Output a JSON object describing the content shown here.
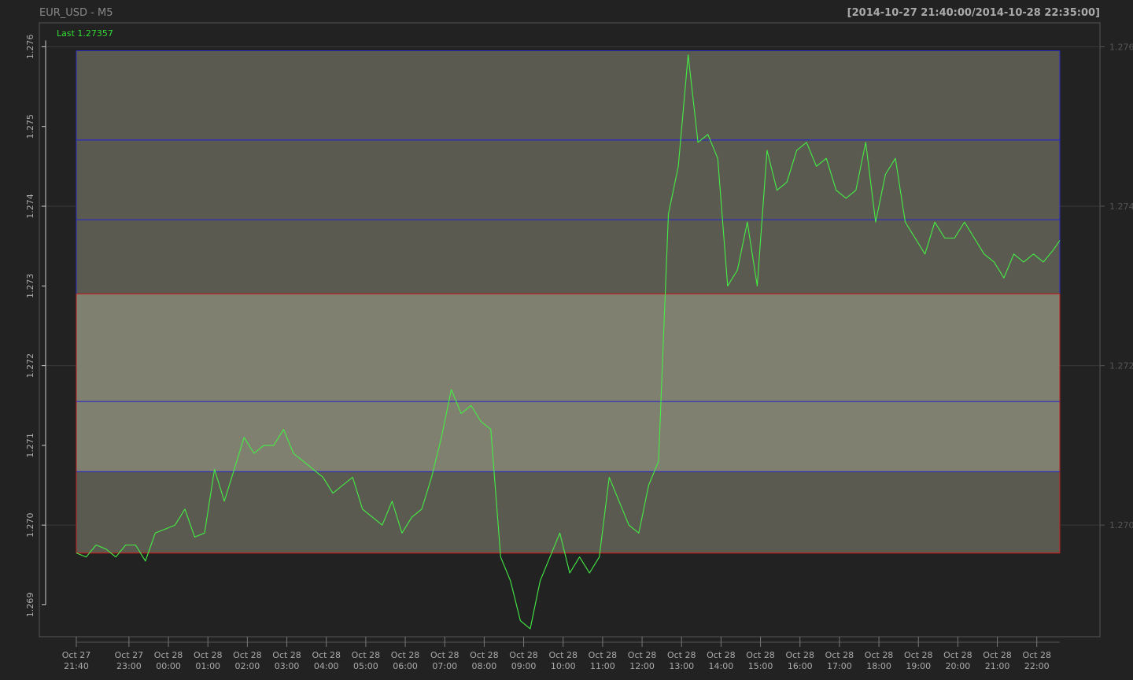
{
  "header": {
    "title": "EUR_USD - M5",
    "date_range": "[2014-10-27 21:40:00/2014-10-28 22:35:00]",
    "last_label": "Last 1.27357"
  },
  "colors": {
    "background": "#222222",
    "plot_frame": "#555555",
    "grid": "#3a3a3a",
    "price_line": "#44ee44",
    "upper_zone_fill": "#5a5a50",
    "middle_zone_fill": "#808070",
    "lower_zone_fill": "#5a5a50",
    "blue_line": "#2a2ac0",
    "red_line": "#c02020",
    "axis_text": "#aaaaaa",
    "right_axis_text": "#555555",
    "title_text": "#888888",
    "range_text": "#aaaaaa",
    "last_text": "#33dd33"
  },
  "chart_data": {
    "type": "line",
    "title": "EUR_USD - M5",
    "series": [
      {
        "name": "",
        "x": [
          "2014-10-27 21:40",
          "2014-10-27 21:55",
          "2014-10-27 22:10",
          "2014-10-27 22:25",
          "2014-10-27 22:40",
          "2014-10-27 22:55",
          "2014-10-27 23:10",
          "2014-10-27 23:25",
          "2014-10-27 23:40",
          "2014-10-27 23:55",
          "2014-10-28 00:10",
          "2014-10-28 00:25",
          "2014-10-28 00:40",
          "2014-10-28 00:55",
          "2014-10-28 01:10",
          "2014-10-28 01:25",
          "2014-10-28 01:40",
          "2014-10-28 01:55",
          "2014-10-28 02:10",
          "2014-10-28 02:25",
          "2014-10-28 02:40",
          "2014-10-28 02:55",
          "2014-10-28 03:10",
          "2014-10-28 03:25",
          "2014-10-28 03:40",
          "2014-10-28 03:55",
          "2014-10-28 04:10",
          "2014-10-28 04:25",
          "2014-10-28 04:40",
          "2014-10-28 04:55",
          "2014-10-28 05:10",
          "2014-10-28 05:25",
          "2014-10-28 05:40",
          "2014-10-28 05:55",
          "2014-10-28 06:10",
          "2014-10-28 06:25",
          "2014-10-28 06:40",
          "2014-10-28 06:55",
          "2014-10-28 07:10",
          "2014-10-28 07:25",
          "2014-10-28 07:40",
          "2014-10-28 07:55",
          "2014-10-28 08:10",
          "2014-10-28 08:25",
          "2014-10-28 08:40",
          "2014-10-28 08:55",
          "2014-10-28 09:10",
          "2014-10-28 09:25",
          "2014-10-28 09:40",
          "2014-10-28 09:55",
          "2014-10-28 10:10",
          "2014-10-28 10:25",
          "2014-10-28 10:40",
          "2014-10-28 10:55",
          "2014-10-28 11:10",
          "2014-10-28 11:25",
          "2014-10-28 11:40",
          "2014-10-28 11:55",
          "2014-10-28 12:10",
          "2014-10-28 12:25",
          "2014-10-28 12:40",
          "2014-10-28 12:55",
          "2014-10-28 13:10",
          "2014-10-28 13:25",
          "2014-10-28 13:40",
          "2014-10-28 13:55",
          "2014-10-28 14:10",
          "2014-10-28 14:25",
          "2014-10-28 14:40",
          "2014-10-28 14:55",
          "2014-10-28 15:10",
          "2014-10-28 15:25",
          "2014-10-28 15:40",
          "2014-10-28 15:55",
          "2014-10-28 16:10",
          "2014-10-28 16:25",
          "2014-10-28 16:40",
          "2014-10-28 16:55",
          "2014-10-28 17:10",
          "2014-10-28 17:25",
          "2014-10-28 17:40",
          "2014-10-28 17:55",
          "2014-10-28 18:10",
          "2014-10-28 18:25",
          "2014-10-28 18:40",
          "2014-10-28 18:55",
          "2014-10-28 19:10",
          "2014-10-28 19:25",
          "2014-10-28 19:40",
          "2014-10-28 19:55",
          "2014-10-28 20:10",
          "2014-10-28 20:25",
          "2014-10-28 20:40",
          "2014-10-28 20:55",
          "2014-10-28 21:10",
          "2014-10-28 21:25",
          "2014-10-28 21:40",
          "2014-10-28 21:55",
          "2014-10-28 22:10",
          "2014-10-28 22:25",
          "2014-10-28 22:35"
        ],
        "values": [
          1.26965,
          1.2696,
          1.26975,
          1.2697,
          1.2696,
          1.26975,
          1.26975,
          1.26955,
          1.2699,
          1.26995,
          1.27,
          1.2702,
          1.26985,
          1.2699,
          1.2707,
          1.2703,
          1.2707,
          1.2711,
          1.2709,
          1.271,
          1.271,
          1.2712,
          1.2709,
          1.2708,
          1.2707,
          1.2706,
          1.2704,
          1.2705,
          1.2706,
          1.2702,
          1.2701,
          1.27,
          1.2703,
          1.2699,
          1.2701,
          1.2702,
          1.2706,
          1.2711,
          1.2717,
          1.2714,
          1.2715,
          1.2713,
          1.2712,
          1.2696,
          1.2693,
          1.2688,
          1.2687,
          1.2693,
          1.2696,
          1.2699,
          1.2694,
          1.2696,
          1.2694,
          1.2696,
          1.2706,
          1.2703,
          1.27,
          1.2699,
          1.2705,
          1.2708,
          1.2739,
          1.2745,
          1.2759,
          1.2748,
          1.2749,
          1.2746,
          1.273,
          1.2732,
          1.2738,
          1.273,
          1.2747,
          1.2742,
          1.2743,
          1.2747,
          1.2748,
          1.2745,
          1.2746,
          1.2742,
          1.2741,
          1.2742,
          1.2748,
          1.2738,
          1.2744,
          1.2746,
          1.2738,
          1.2736,
          1.2734,
          1.2738,
          1.2736,
          1.2736,
          1.2738,
          1.2736,
          1.2734,
          1.2733,
          1.2731,
          1.2734,
          1.2733,
          1.2734,
          1.2733,
          1.27345,
          1.27357
        ]
      }
    ],
    "zones": [
      {
        "name": "upper",
        "from": 1.2729,
        "to": 1.27595
      },
      {
        "name": "middle",
        "from": 1.27067,
        "to": 1.2729
      },
      {
        "name": "lower",
        "from": 1.26965,
        "to": 1.27067
      }
    ],
    "horizontal_lines": [
      {
        "level": 1.27483,
        "color": "blue"
      },
      {
        "level": 1.27383,
        "color": "blue"
      },
      {
        "level": 1.27155,
        "color": "blue"
      },
      {
        "level": 1.27067,
        "color": "blue"
      },
      {
        "level": 1.2729,
        "color": "red"
      },
      {
        "level": 1.26965,
        "color": "red"
      }
    ],
    "ylim": [
      1.2686,
      1.2763
    ],
    "left_ticks": [
      1.269,
      1.27,
      1.271,
      1.272,
      1.273,
      1.274,
      1.275,
      1.276
    ],
    "left_tick_labels": [
      "1.269",
      "1.270",
      "1.271",
      "1.272",
      "1.273",
      "1.274",
      "1.275",
      "1.276"
    ],
    "right_ticks": [
      1.27,
      1.272,
      1.274,
      1.276
    ],
    "right_tick_labels": [
      "1.270",
      "1.272",
      "1.274",
      "1.276"
    ],
    "x_ticks": [
      {
        "time": "2014-10-27 21:40",
        "line1": "Oct 27",
        "line2": "21:40"
      },
      {
        "time": "2014-10-27 23:00",
        "line1": "Oct 27",
        "line2": "23:00"
      },
      {
        "time": "2014-10-28 00:00",
        "line1": "Oct 28",
        "line2": "00:00"
      },
      {
        "time": "2014-10-28 01:00",
        "line1": "Oct 28",
        "line2": "01:00"
      },
      {
        "time": "2014-10-28 02:00",
        "line1": "Oct 28",
        "line2": "02:00"
      },
      {
        "time": "2014-10-28 03:00",
        "line1": "Oct 28",
        "line2": "03:00"
      },
      {
        "time": "2014-10-28 04:00",
        "line1": "Oct 28",
        "line2": "04:00"
      },
      {
        "time": "2014-10-28 05:00",
        "line1": "Oct 28",
        "line2": "05:00"
      },
      {
        "time": "2014-10-28 06:00",
        "line1": "Oct 28",
        "line2": "06:00"
      },
      {
        "time": "2014-10-28 07:00",
        "line1": "Oct 28",
        "line2": "07:00"
      },
      {
        "time": "2014-10-28 08:00",
        "line1": "Oct 28",
        "line2": "08:00"
      },
      {
        "time": "2014-10-28 09:00",
        "line1": "Oct 28",
        "line2": "09:00"
      },
      {
        "time": "2014-10-28 10:00",
        "line1": "Oct 28",
        "line2": "10:00"
      },
      {
        "time": "2014-10-28 11:00",
        "line1": "Oct 28",
        "line2": "11:00"
      },
      {
        "time": "2014-10-28 12:00",
        "line1": "Oct 28",
        "line2": "12:00"
      },
      {
        "time": "2014-10-28 13:00",
        "line1": "Oct 28",
        "line2": "13:00"
      },
      {
        "time": "2014-10-28 14:00",
        "line1": "Oct 28",
        "line2": "14:00"
      },
      {
        "time": "2014-10-28 15:00",
        "line1": "Oct 28",
        "line2": "15:00"
      },
      {
        "time": "2014-10-28 16:00",
        "line1": "Oct 28",
        "line2": "16:00"
      },
      {
        "time": "2014-10-28 17:00",
        "line1": "Oct 28",
        "line2": "17:00"
      },
      {
        "time": "2014-10-28 18:00",
        "line1": "Oct 28",
        "line2": "18:00"
      },
      {
        "time": "2014-10-28 19:00",
        "line1": "Oct 28",
        "line2": "19:00"
      },
      {
        "time": "2014-10-28 20:00",
        "line1": "Oct 28",
        "line2": "20:00"
      },
      {
        "time": "2014-10-28 21:00",
        "line1": "Oct 28",
        "line2": "21:00"
      },
      {
        "time": "2014-10-28 22:00",
        "line1": "Oct 28",
        "line2": "22:00"
      }
    ],
    "xlim": [
      "2014-10-27 21:40",
      "2014-10-28 22:35"
    ],
    "grid": true
  }
}
